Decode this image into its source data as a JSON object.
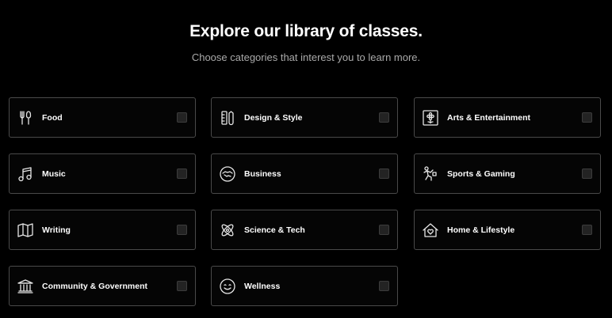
{
  "header": {
    "title": "Explore our library of classes.",
    "subtitle": "Choose categories that interest you to learn more."
  },
  "categories": [
    {
      "label": "Food",
      "icon": "fork-spoon-icon",
      "checked": false
    },
    {
      "label": "Design & Style",
      "icon": "ruler-pencil-icon",
      "checked": false
    },
    {
      "label": "Arts & Entertainment",
      "icon": "flower-frame-icon",
      "checked": false
    },
    {
      "label": "Music",
      "icon": "music-note-icon",
      "checked": false
    },
    {
      "label": "Business",
      "icon": "handshake-icon",
      "checked": false
    },
    {
      "label": "Sports & Gaming",
      "icon": "athlete-icon",
      "checked": false
    },
    {
      "label": "Writing",
      "icon": "open-book-icon",
      "checked": false
    },
    {
      "label": "Science & Tech",
      "icon": "atom-icon",
      "checked": false
    },
    {
      "label": "Home & Lifestyle",
      "icon": "house-heart-icon",
      "checked": false
    },
    {
      "label": "Community & Government",
      "icon": "government-building-icon",
      "checked": false
    },
    {
      "label": "Wellness",
      "icon": "smiley-icon",
      "checked": false
    }
  ]
}
